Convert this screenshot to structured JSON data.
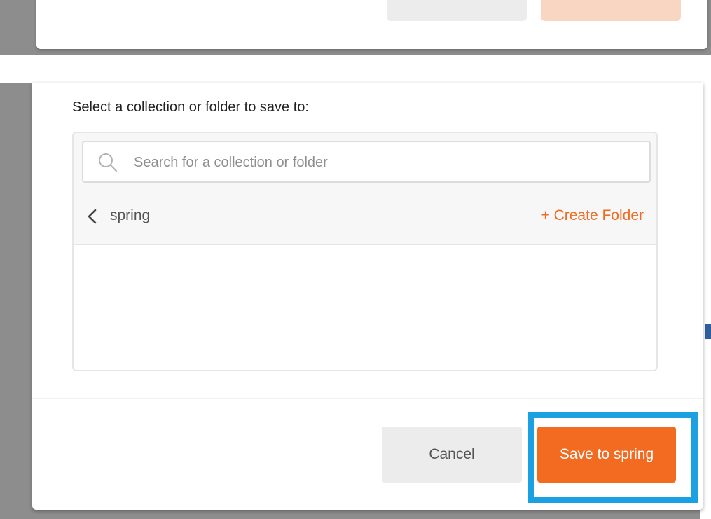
{
  "dialog": {
    "prompt": "Select a collection or folder to save to:",
    "search": {
      "placeholder": "Search for a collection or folder",
      "value": ""
    },
    "breadcrumb": {
      "current": "spring"
    },
    "create_folder_label": "+ Create Folder",
    "buttons": {
      "cancel": "Cancel",
      "save": "Save to spring"
    }
  },
  "colors": {
    "accent": "#f26b21",
    "highlight": "#1ba1e2",
    "overlay": "#8d8d8d"
  },
  "icons": [
    "search-icon",
    "chevron-left-icon"
  ]
}
